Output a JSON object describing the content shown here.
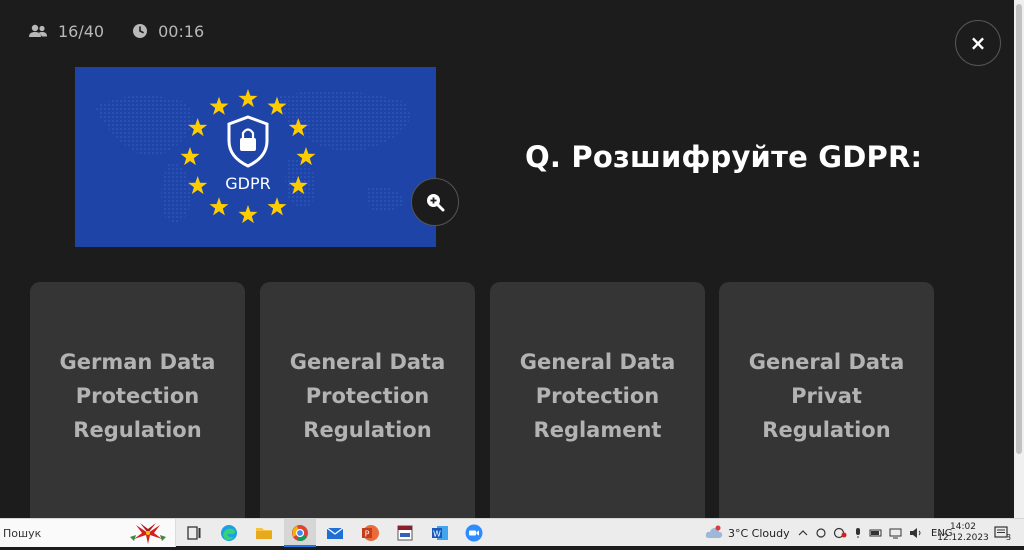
{
  "header": {
    "participants": "16/40",
    "timer": "00:16",
    "close_label": "×"
  },
  "image": {
    "caption": "GDPR"
  },
  "question": {
    "text": "Q. Розшифруйте GDPR:"
  },
  "options": [
    {
      "label": "German Data Protection Regulation"
    },
    {
      "label": "General Data Protection Regulation"
    },
    {
      "label": "General Data Protection Reglament"
    },
    {
      "label": "General Data Privat Regulation"
    }
  ],
  "taskbar": {
    "search_text": "Пошук",
    "weather": "3°C  Cloudy",
    "lang": "ENG",
    "time": "14:02",
    "date": "12.12.2023",
    "notif_count": "3"
  },
  "colors": {
    "background": "#1c1c1c",
    "card": "#353535",
    "eu_blue": "#1e44a8",
    "star": "#ffcc00"
  }
}
